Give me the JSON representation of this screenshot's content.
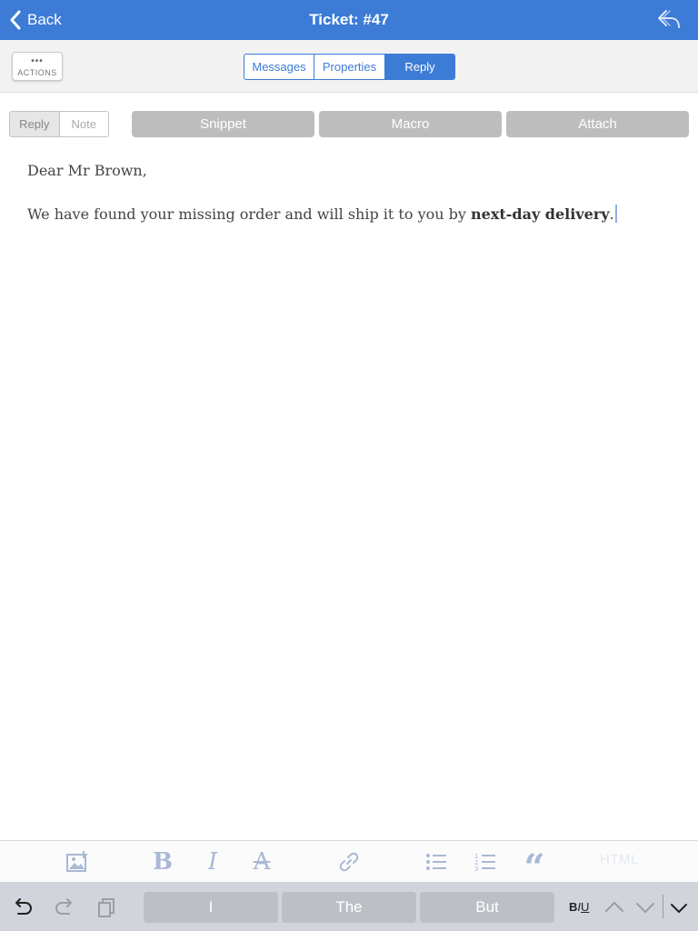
{
  "nav": {
    "back_label": "Back",
    "title": "Ticket: #47"
  },
  "subbar": {
    "actions_dots": "•••",
    "actions_label": "ACTIONS",
    "tabs": [
      {
        "label": "Messages",
        "selected": false
      },
      {
        "label": "Properties",
        "selected": false
      },
      {
        "label": "Reply",
        "selected": true
      }
    ]
  },
  "compose": {
    "mode_toggle": [
      {
        "label": "Reply",
        "selected": true
      },
      {
        "label": "Note",
        "selected": false
      }
    ],
    "snippet_label": "Snippet",
    "macro_label": "Macro",
    "attach_label": "Attach"
  },
  "editor": {
    "greeting": "Dear Mr Brown,",
    "body_before": "We have found your missing order and will ship it to you by ",
    "body_bold": "next-day delivery",
    "body_after": "."
  },
  "format_toolbar": {
    "icons": [
      "insert-image-icon",
      "bold-icon",
      "italic-icon",
      "strikethrough-icon",
      "link-icon",
      "bulleted-list-icon",
      "numbered-list-icon",
      "blockquote-icon"
    ],
    "bold_glyph": "B",
    "italic_glyph": "I",
    "strike_glyph": "A",
    "quote_glyph": "“",
    "html_label": "HTML"
  },
  "keyboard_bar": {
    "suggestions": [
      "I",
      "The",
      "But"
    ],
    "biu": {
      "b": "B",
      "i": "I",
      "u": "U"
    }
  },
  "colors": {
    "accent": "#3c7bd6",
    "toolbar_icon": "#a9b8d4",
    "gray_button": "#bdbdbd",
    "keyboard_bar": "#d1d5db"
  }
}
